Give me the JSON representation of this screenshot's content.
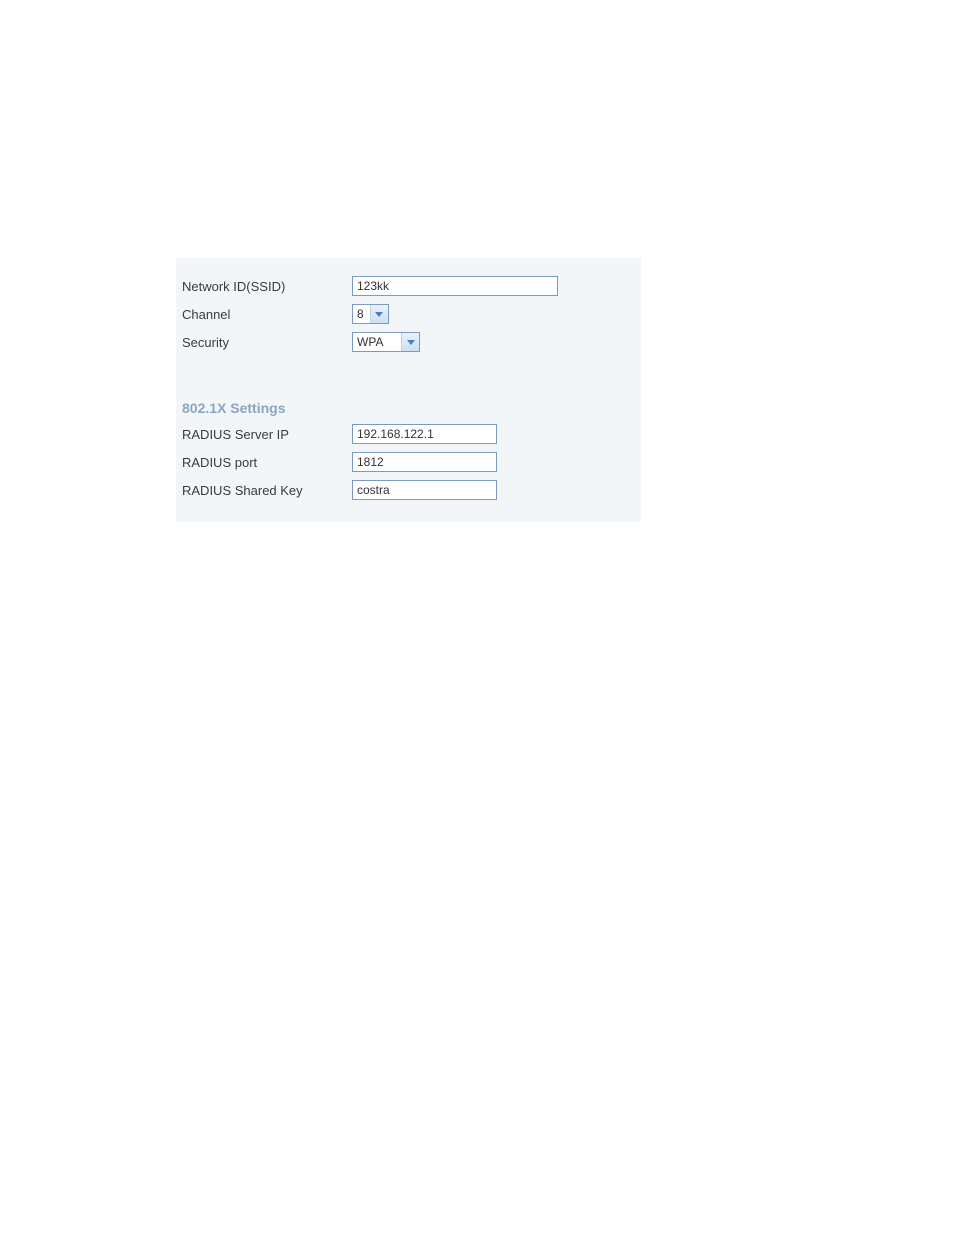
{
  "network": {
    "ssid_label": "Network ID(SSID)",
    "ssid_value": "123kk",
    "channel_label": "Channel",
    "channel_value": "8",
    "security_label": "Security",
    "security_value": "WPA"
  },
  "section": {
    "title": "802.1X Settings"
  },
  "radius": {
    "server_ip_label": "RADIUS Server IP",
    "server_ip_value": "192.168.122.1",
    "port_label": "RADIUS port",
    "port_value": "1812",
    "shared_key_label": "RADIUS Shared Key",
    "shared_key_value": "costra"
  }
}
